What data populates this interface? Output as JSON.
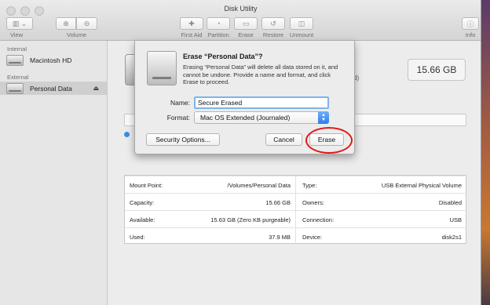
{
  "window": {
    "title": "Disk Utility"
  },
  "toolbar": {
    "view_label": "View",
    "volume_label": "Volume",
    "first_aid_label": "First Aid",
    "partition_label": "Partition",
    "erase_label": "Erase",
    "restore_label": "Restore",
    "unmount_label": "Unmount",
    "info_label": "Info"
  },
  "sidebar": {
    "internal_header": "Internal",
    "external_header": "External",
    "items": [
      {
        "label": "Macintosh HD"
      },
      {
        "label": "Personal Data",
        "eject": "⏏"
      }
    ]
  },
  "main": {
    "capacity": "15.66 GB",
    "partial_text": "d)",
    "info": {
      "left": [
        {
          "label": "Mount Point:",
          "value": "/Volumes/Personal Data"
        },
        {
          "label": "Capacity:",
          "value": "15.66 GB"
        },
        {
          "label": "Available:",
          "value": "15.63 GB (Zero KB purgeable)"
        },
        {
          "label": "Used:",
          "value": "37.9 MB"
        }
      ],
      "right": [
        {
          "label": "Type:",
          "value": "USB External Physical Volume"
        },
        {
          "label": "Owners:",
          "value": "Disabled"
        },
        {
          "label": "Connection:",
          "value": "USB"
        },
        {
          "label": "Device:",
          "value": "disk2s1"
        }
      ]
    }
  },
  "dialog": {
    "title": "Erase “Personal Data”?",
    "message": "Erasing “Personal Data” will delete all data stored on it, and cannot be undone. Provide a name and format, and click Erase to proceed.",
    "name_label": "Name:",
    "name_value": "Secure Erased",
    "format_label": "Format:",
    "format_value": "Mac OS Extended (Journaled)",
    "security_button": "Security Options...",
    "cancel_button": "Cancel",
    "erase_button": "Erase"
  },
  "colors": {
    "highlight_circle": "#e01818",
    "focus_ring": "#7eb4ea",
    "select_accent": "#2f7fe8"
  }
}
